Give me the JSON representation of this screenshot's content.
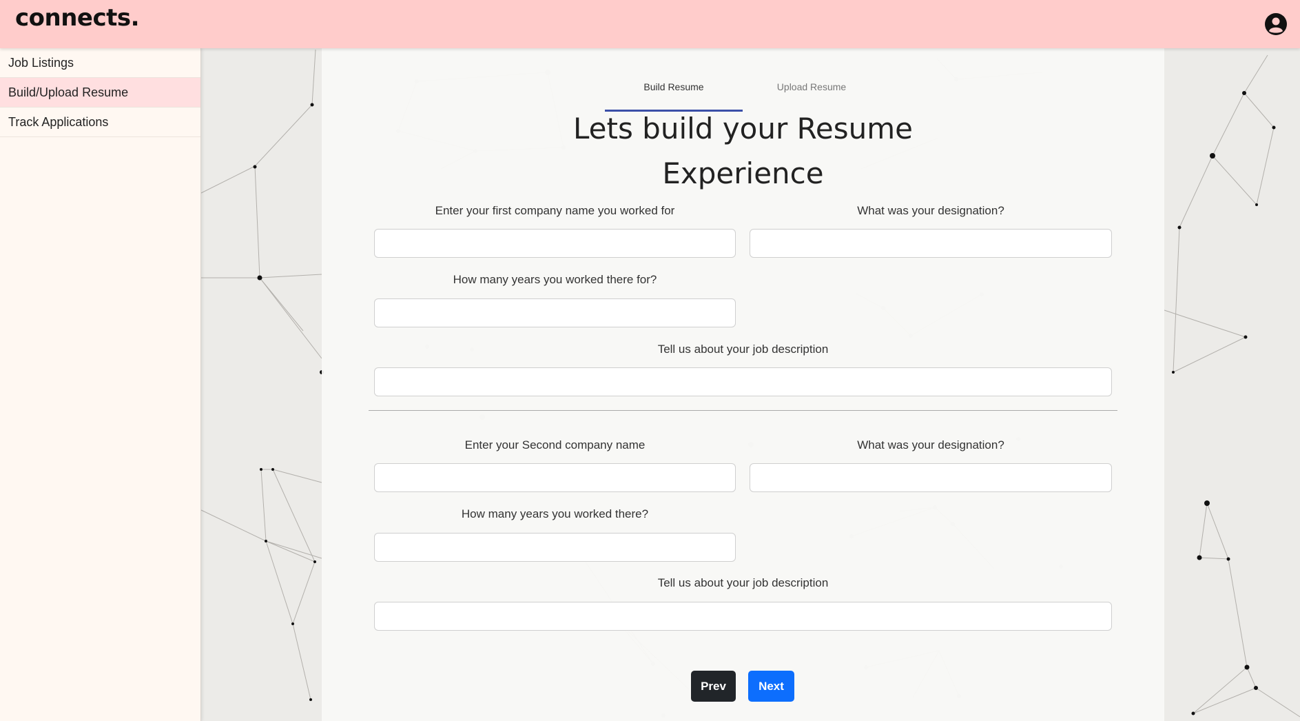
{
  "header": {
    "brand": "connects.",
    "user_icon": "user-circle-icon"
  },
  "sidebar": {
    "items": [
      {
        "label": "Job Listings",
        "active": false
      },
      {
        "label": "Build/Upload Resume",
        "active": true
      },
      {
        "label": "Track Applications",
        "active": false
      }
    ]
  },
  "tabs": {
    "build": "Build Resume",
    "upload": "Upload Resume",
    "active": "build"
  },
  "main": {
    "title": "Lets build your Resume",
    "subtitle": "Experience",
    "first_company": {
      "company_label": "Enter your first company name you worked for",
      "company_value": "",
      "designation_label": "What was your designation?",
      "designation_value": "",
      "years_label": "How many years you worked there for?",
      "years_value": "",
      "description_label": "Tell us about your job description",
      "description_value": ""
    },
    "second_company": {
      "company_label": "Enter your Second company name",
      "company_value": "",
      "designation_label": "What was your designation?",
      "designation_value": "",
      "years_label": "How many years you worked there?",
      "years_value": "",
      "description_label": "Tell us about your job description",
      "description_value": ""
    },
    "prev_label": "Prev",
    "next_label": "Next"
  },
  "colors": {
    "header_bg": "#ffcccb",
    "sidebar_bg": "#fff8f2",
    "sidebar_active": "#ffdfe0",
    "tab_underline": "#3b4fa8",
    "prev_button": "#212529",
    "next_button": "#0d6efd"
  }
}
